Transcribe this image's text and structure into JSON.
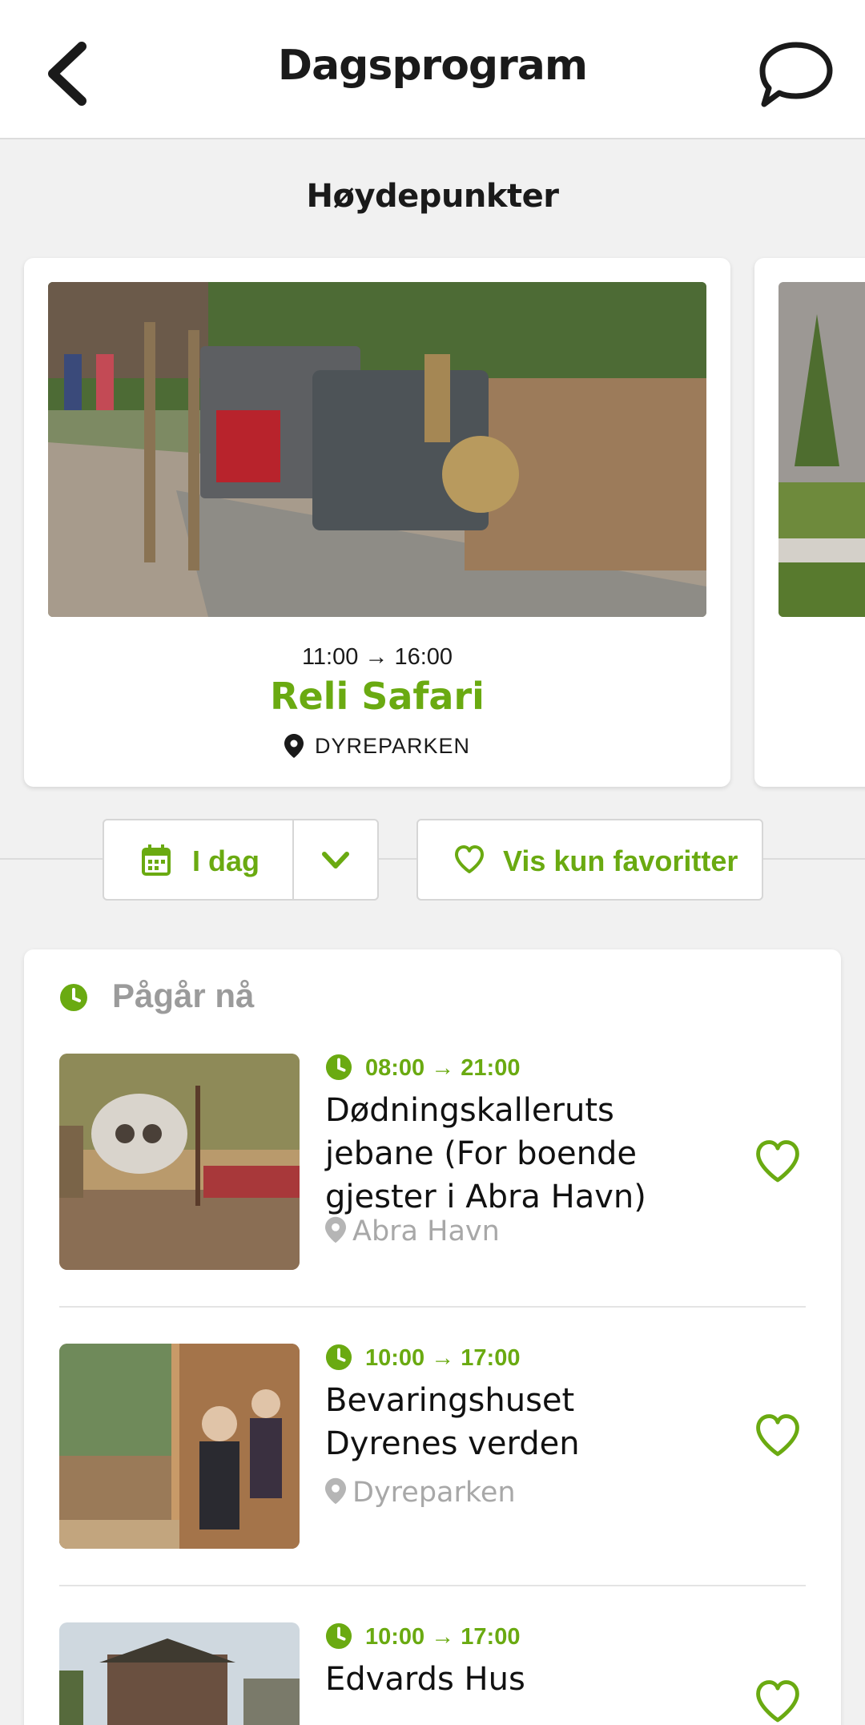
{
  "header": {
    "title": "Dagsprogram",
    "back_icon": "chevron-left-icon",
    "chat_icon": "chat-bubble-icon"
  },
  "highlights": {
    "title": "Høydepunkter",
    "cards": [
      {
        "time": "11:00 → 16:00",
        "name": "Reli Safari",
        "location": "DYREPARKEN",
        "image": "train-ride-photo"
      }
    ],
    "peek_image": "garden-rock-photo"
  },
  "filters": {
    "day_label": "I dag",
    "day_icon": "calendar-icon",
    "dropdown_icon": "chevron-down-icon",
    "favorites_label": "Vis kun favoritter",
    "favorites_icon": "heart-outline-icon"
  },
  "now_section": {
    "label": "Pågår nå",
    "icon": "clock-icon",
    "events": [
      {
        "time": "08:00 → 21:00",
        "title": "Dødningskalleruts jebane (For boende gjester i Abra Havn)",
        "location": "Abra Havn",
        "image": "pirate-ship-photo"
      },
      {
        "time": "10:00 → 17:00",
        "title": "Bevaringshuset Dyrenes verden",
        "location": "Dyreparken",
        "image": "visitors-exhibit-photo"
      },
      {
        "time": "10:00 → 17:00",
        "title": "Edvards Hus",
        "location": "",
        "image": "wooden-house-photo"
      }
    ]
  },
  "colors": {
    "accent_green": "#6aaa11",
    "muted_gray": "#a8a8a8",
    "background": "#f1f1f1"
  }
}
